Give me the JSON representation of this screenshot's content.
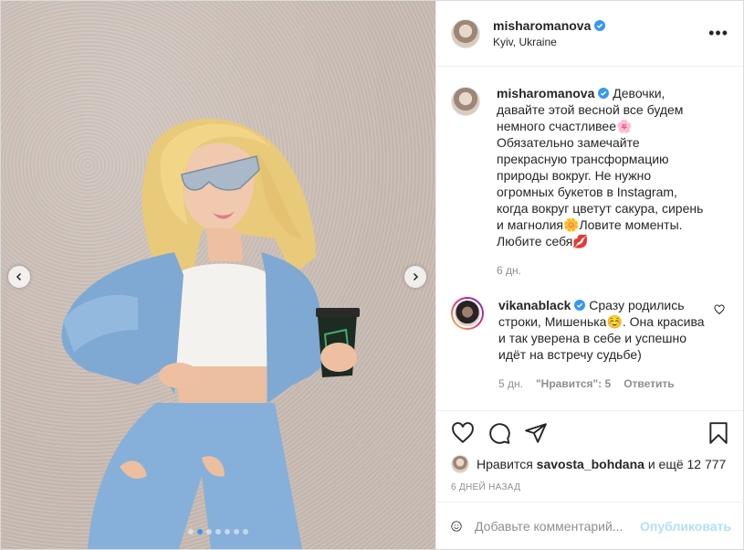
{
  "header": {
    "username": "misharomanova",
    "location": "Kyiv, Ukraine",
    "more": "•••"
  },
  "caption": {
    "username": "misharomanova",
    "text": "Девочки, давайте этой весной все будем немного счастливее🌸Обязательно замечайте прекрасную трансформацию природы вокруг. Не нужно огромных букетов в Instagram, когда вокруг цветут сакура, сирень и магнолия🌼Ловите моменты. Любите себя💋",
    "time": "6 дн."
  },
  "comment": {
    "username": "vikanablack",
    "text": "Сразу родились строки, Мишенька☺️. Она красива и так уверена в себе и успешно идёт на встречу судьбе)",
    "time": "5 дн.",
    "likes": "\"Нравится\": 5",
    "reply": "Ответить"
  },
  "likes": {
    "prefix": "Нравится",
    "user": "savosta_bohdana",
    "suffix": "и ещё 12 777"
  },
  "time_ago": "6 дней назад",
  "add_comment": {
    "placeholder": "Добавьте комментарий...",
    "publish": "Опубликовать"
  },
  "carousel": {
    "total": 7,
    "active": 1
  },
  "colors": {
    "accent": "#3897f0",
    "publish_disabled": "#b2dffc",
    "text": "#262626",
    "muted": "#8e8e8e"
  },
  "icons": [
    "heart-icon",
    "comment-icon",
    "share-icon",
    "bookmark-icon",
    "emoji-icon",
    "verified-icon",
    "chevron-left-icon",
    "chevron-right-icon"
  ]
}
